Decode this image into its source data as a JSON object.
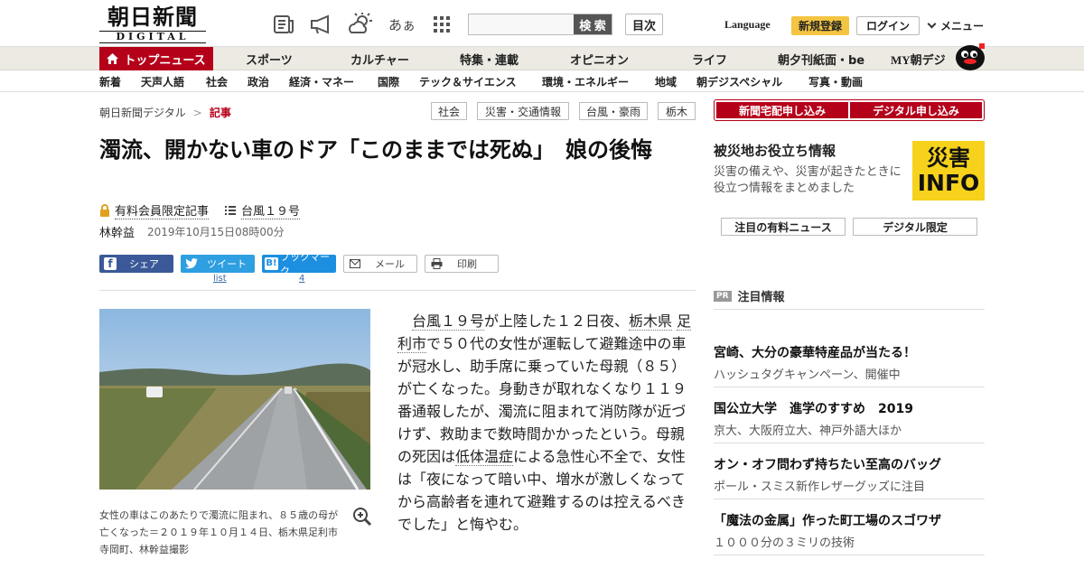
{
  "header": {
    "logo_jp": "朝日新聞",
    "logo_en": "DIGITAL",
    "icons": [
      "newspaper-icon",
      "megaphone-icon",
      "weather-icon",
      "font-size-icon",
      "grid-menu-icon"
    ],
    "font_icon_text": "あぁ",
    "search_button": "検 索",
    "index_button": "目次",
    "language": "Language",
    "signup": "新規登録",
    "login": "ログイン",
    "menu": "メニュー"
  },
  "nav_primary": [
    "トップニュース",
    "スポーツ",
    "カルチャー",
    "特集・連載",
    "オピニオン",
    "ライフ",
    "朝夕刊紙面・be",
    "MY朝デジ"
  ],
  "nav_secondary": [
    "新着",
    "天声人語",
    "社会",
    "政治",
    "経済・マネー",
    "国際",
    "テック＆サイエンス",
    "環境・エネルギー",
    "地域",
    "朝デジスペシャル",
    "写真・動画"
  ],
  "breadcrumb": {
    "home": "朝日新聞デジタル",
    "separator": ">",
    "current": "記事"
  },
  "tags": [
    "社会",
    "災害・交通情報",
    "台風・豪雨",
    "栃木"
  ],
  "article": {
    "title": "濁流、開かない車のドア「このままでは死ぬ」　娘の後悔",
    "members_label": "有料会員限定記事",
    "series_label": "台風１９号",
    "author": "林幹益",
    "date": "2019年10月15日08時00分",
    "share": {
      "facebook": "シェア",
      "twitter": "ツイート",
      "twitter_count": "list",
      "hatena": "ブックマーク",
      "hatena_count": "4",
      "mail": "メール",
      "print": "印刷"
    },
    "caption": "女性の車はこのあたりで濁流に阻まれ、８５歳の母が亡くなった＝２０１９年１０月１４日、栃木県足利市寺岡町、林幹益撮影",
    "body": {
      "link1": "台風１９号",
      "t1": "が上陸した１２日夜、",
      "link2": "栃木県",
      "t2": " ",
      "link3": "足利市",
      "t3": "で５０代の女性が運転して避難途中の車が冠水し、助手席に乗っていた母親（８５）が亡くなった。身動きが取れなくなり１１９番通報したが、濁流に阻まれて消防隊が近づけず、救助まで数時間かかったという。母親の死因は",
      "link4": "低体温症",
      "t4": "による急性心不全で、女性は「夜になって暗い中、増水が激しくなってから高齢者を連れて避難するのは控えるべきでした」と悔やむ。"
    }
  },
  "sidebar": {
    "delivery_button": "新聞宅配申し込み",
    "digital_button": "デジタル申し込み",
    "disaster_title": "被災地お役立ち情報",
    "disaster_text": "災害の備えや、災害が起きたときに役立つ情報をまとめました",
    "disaster_logo_top": "災害",
    "disaster_logo_bottom": "INFO",
    "tab1": "注目の有料ニュース",
    "tab2": "デジタル限定",
    "pr_badge": "PR",
    "pr_title": "注目情報",
    "pr_items": [
      {
        "headline": "宮崎、大分の豪華特産品が当たる！",
        "sub": "ハッシュタグキャンペーン、開催中"
      },
      {
        "headline": "国公立大学　進学のすすめ　2019",
        "sub": "京大、大阪府立大、神戸外語大ほか"
      },
      {
        "headline": "オン・オフ問わず持ちたい至高のバッグ",
        "sub": "ポール・スミス新作レザーグッズに注目"
      },
      {
        "headline": "「魔法の金属」作った町工場のスゴワザ",
        "sub": "１０００分の３ミリの技術"
      }
    ]
  }
}
